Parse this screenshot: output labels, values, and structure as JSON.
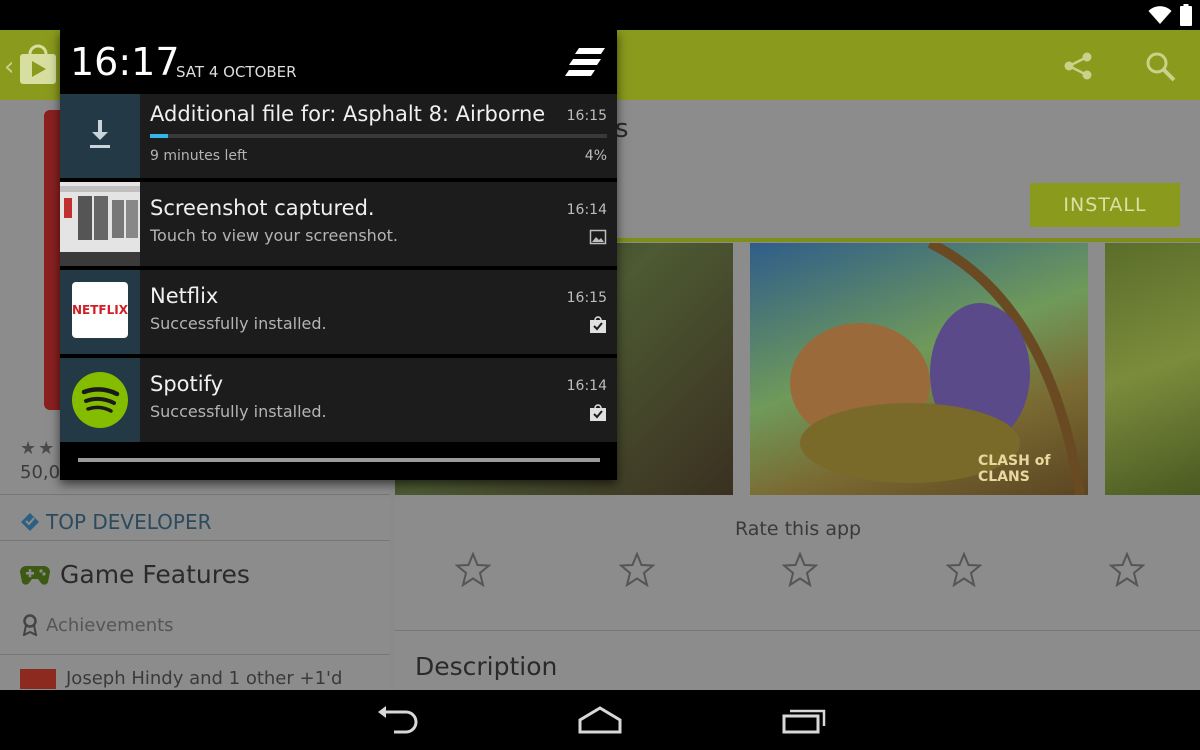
{
  "status_bar": {
    "icons": [
      "wifi-icon",
      "battery-icon"
    ]
  },
  "notification_shade": {
    "time": "16:17",
    "date": "SAT 4 OCTOBER",
    "notifications": [
      {
        "icon": "download-icon",
        "title": "Additional file for: Asphalt 8: Airborne",
        "time": "16:15",
        "subtitle": "9 minutes left",
        "info": "4%",
        "progress": 0.04,
        "accent_color": "#33b5e5"
      },
      {
        "icon": "screenshot-thumbnail",
        "title": "Screenshot captured.",
        "time": "16:14",
        "subtitle": "Touch to view your screenshot.",
        "badge": "image-icon"
      },
      {
        "icon": "netflix-logo",
        "logo_text": "NETFLIX",
        "title": "Netflix",
        "time": "16:15",
        "subtitle": "Successfully installed.",
        "badge": "shopping-bag-check-icon"
      },
      {
        "icon": "spotify-logo",
        "title": "Spotify",
        "time": "16:14",
        "subtitle": "Successfully installed.",
        "badge": "shopping-bag-check-icon"
      }
    ]
  },
  "play_store": {
    "brand_color": "#8a9a1c",
    "title_fragment": "s",
    "install_label": "INSTALL",
    "downloads_fragment": "50,0",
    "top_developer": "TOP DEVELOPER",
    "game_features": "Game Features",
    "achievements": "Achievements",
    "plus_one_text": "Joseph Hindy and 1 other +1'd",
    "screenshot_overlay_text": "CLASH of CLANS",
    "rate_label": "Rate this app",
    "rating_stars": 5,
    "description_label": "Description"
  },
  "nav_bar": {
    "buttons": [
      "back-icon",
      "home-icon",
      "recent-apps-icon"
    ]
  }
}
